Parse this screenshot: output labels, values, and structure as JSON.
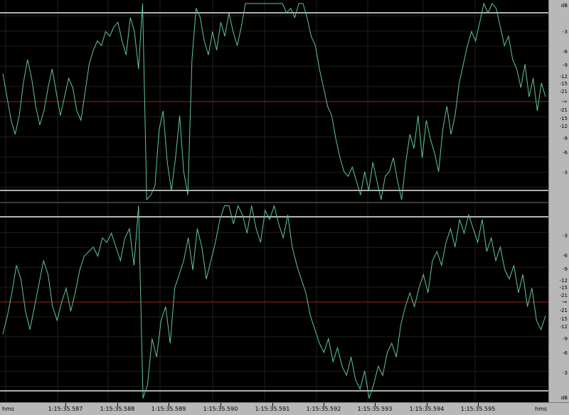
{
  "ruler": {
    "time_unit": "hms",
    "time_labels": [
      "1:15:35.587",
      "1:15:35.588",
      "1:15:35.589",
      "1:15:35.590",
      "1:15:35.591",
      "1:15:35.592",
      "1:15:35.593",
      "1:15:35.594",
      "1:15:35.595"
    ],
    "db_unit": "dB",
    "db_labels_top": [
      "-3",
      "-6",
      "-9",
      "-12",
      "-15",
      "-21",
      "-∞",
      "-21",
      "-15",
      "-12",
      "-9",
      "-6",
      "-3"
    ],
    "db_labels_bottom": [
      "-3",
      "-6",
      "-9",
      "-12",
      "-15",
      "-21",
      "-∞",
      "-21",
      "-15",
      "-12",
      "-9",
      "-6",
      "-3"
    ]
  },
  "colors": {
    "background": "#000000",
    "waveform": "#5fc79a",
    "center_line": "#a02020",
    "clip_line": "#e8e8e8",
    "grid": "#1e1e1e",
    "ruler": "#b8b8b8"
  },
  "channels": [
    {
      "id": "left",
      "samples": [
        0.6,
        0.1,
        -0.4,
        -0.7,
        -0.3,
        0.4,
        0.9,
        0.5,
        -0.1,
        -0.5,
        -0.2,
        0.3,
        0.7,
        0.2,
        -0.3,
        0.1,
        0.5,
        0.3,
        -0.2,
        -0.4,
        0.2,
        0.8,
        1.1,
        1.3,
        1.2,
        1.5,
        1.4,
        1.6,
        1.7,
        1.3,
        1.0,
        1.8,
        1.5,
        0.7,
        2.1,
        -2.1,
        -2.0,
        -1.8,
        -0.6,
        -0.2,
        -1.3,
        -1.9,
        -1.2,
        -0.3,
        -1.5,
        -2.0,
        0.9,
        2.0,
        1.8,
        1.3,
        1.0,
        1.5,
        1.1,
        1.7,
        1.4,
        1.9,
        1.5,
        1.2,
        1.6,
        2.1,
        2.1,
        2.1,
        2.1,
        2.1,
        2.1,
        2.1,
        2.1,
        2.1,
        2.1,
        1.9,
        2.0,
        1.8,
        2.1,
        2.1,
        1.8,
        1.4,
        1.2,
        0.7,
        0.3,
        -0.1,
        -0.3,
        -0.8,
        -1.2,
        -1.5,
        -1.6,
        -1.4,
        -1.7,
        -2.0,
        -1.5,
        -1.9,
        -1.3,
        -1.7,
        -2.1,
        -1.6,
        -1.5,
        -1.2,
        -1.7,
        -2.1,
        -1.3,
        -0.7,
        -1.0,
        -0.3,
        -1.2,
        -0.4,
        -0.8,
        -1.1,
        -1.5,
        -0.6,
        -0.1,
        -0.7,
        -0.3,
        0.4,
        0.8,
        1.2,
        1.5,
        1.3,
        1.7,
        2.1,
        1.9,
        2.1,
        2.0,
        1.6,
        1.2,
        1.4,
        0.9,
        0.7,
        0.3,
        0.8,
        0.1,
        0.5,
        -0.2,
        0.4,
        0.1
      ]
    },
    {
      "id": "right",
      "samples": [
        -0.7,
        -0.3,
        0.2,
        0.8,
        0.5,
        -0.2,
        -0.6,
        -0.1,
        0.4,
        0.9,
        0.6,
        -0.1,
        -0.4,
        0.0,
        0.3,
        -0.2,
        0.2,
        0.7,
        1.0,
        1.1,
        1.2,
        1.0,
        1.4,
        1.3,
        1.5,
        1.2,
        0.9,
        1.4,
        1.6,
        0.8,
        2.1,
        -2.1,
        -1.8,
        -0.8,
        -1.2,
        -0.4,
        -0.1,
        -0.9,
        0.3,
        0.6,
        0.9,
        1.4,
        0.7,
        1.6,
        1.2,
        0.5,
        0.9,
        1.3,
        1.8,
        2.1,
        2.1,
        1.7,
        2.1,
        1.9,
        1.5,
        2.1,
        1.6,
        1.3,
        2.0,
        1.8,
        2.1,
        1.7,
        1.4,
        1.9,
        1.2,
        0.8,
        0.5,
        0.2,
        -0.3,
        -0.6,
        -0.9,
        -1.1,
        -0.8,
        -1.3,
        -1.0,
        -1.4,
        -1.6,
        -1.2,
        -1.7,
        -1.9,
        -1.5,
        -2.1,
        -1.8,
        -1.4,
        -1.6,
        -1.1,
        -0.9,
        -1.2,
        -0.5,
        -0.1,
        0.2,
        -0.1,
        0.3,
        0.6,
        0.2,
        0.9,
        1.1,
        0.8,
        1.3,
        1.6,
        1.2,
        1.8,
        1.5,
        1.9,
        1.6,
        1.3,
        1.8,
        1.1,
        1.4,
        0.9,
        1.2,
        0.7,
        0.5,
        0.8,
        0.2,
        0.6,
        -0.1,
        0.3,
        -0.4,
        -0.6,
        -0.3
      ]
    }
  ]
}
